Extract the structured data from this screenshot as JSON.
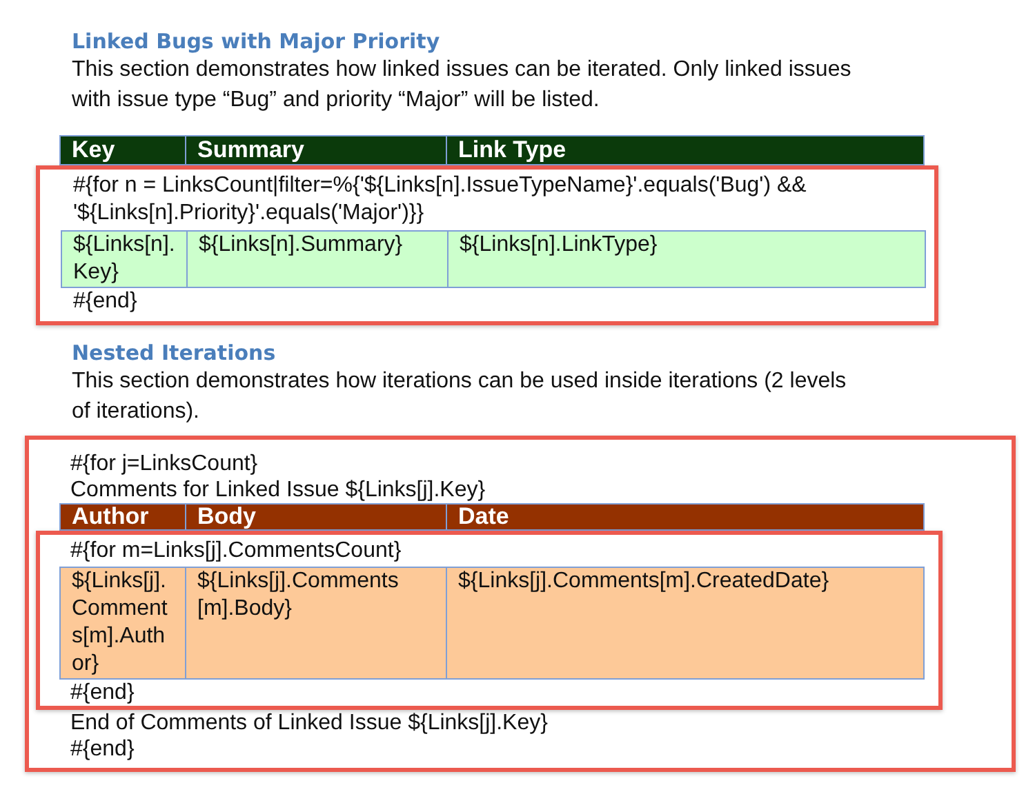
{
  "sections": [
    {
      "kind": "filtered",
      "heading": "Linked Bugs with Major Priority",
      "description": "This section demonstrates how linked issues can be iterated. Only linked issues with issue type “Bug” and priority “Major” will be listed.",
      "table": {
        "columns": [
          "Key",
          "Summary",
          "Link Type"
        ]
      },
      "loop": {
        "open": "#{for n = LinksCount|filter=%{'${Links[n].IssueTypeName}'.equals('Bug') && '${Links[n].Priority}'.equals('Major')}}",
        "row": [
          "${Links[n].Key}",
          "${Links[n].Summary}",
          "${Links[n].LinkType}"
        ],
        "close": "#{end}"
      }
    },
    {
      "kind": "nested",
      "heading": "Nested Iterations",
      "description": "This section demonstrates how iterations can be used inside iterations (2 levels of iterations).",
      "table": {
        "columns": [
          "Author",
          "Body",
          "Date"
        ]
      },
      "outer_loop": {
        "open": "#{for j=LinksCount}",
        "caption": "Comments for Linked Issue ${Links[j].Key}",
        "after": "End of Comments of Linked Issue ${Links[j].Key}",
        "close": "#{end}"
      },
      "loop": {
        "open": "#{for m=Links[j].CommentsCount}",
        "row": [
          "${Links[j].Comments[m].Author}",
          "${Links[j].Comments[m].Body}",
          "${Links[j].Comments[m].CreatedDate}"
        ],
        "close": "#{end}"
      }
    }
  ]
}
